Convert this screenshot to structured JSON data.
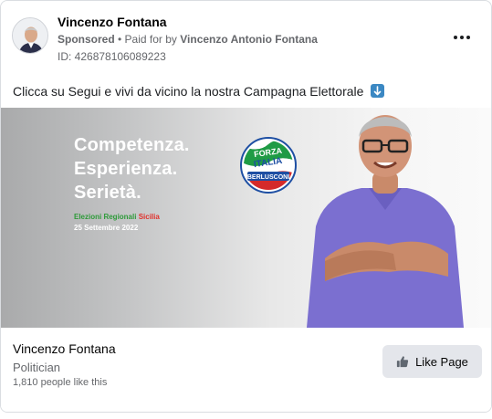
{
  "header": {
    "page_name": "Vincenzo Fontana",
    "sponsored_label": "Sponsored",
    "separator": " • ",
    "paid_for_prefix": "Paid for by ",
    "paid_for_name": "Vincenzo Antonio Fontana",
    "ad_id": "ID: 426878106089223",
    "more_icon": "more-horizontal-icon"
  },
  "post": {
    "caption": "Clicca su Segui e vivi da vicino la nostra Campagna Elettorale",
    "caption_emoji": "arrow-down-emoji"
  },
  "creative": {
    "headline_lines": [
      "Competenza.",
      "Esperienza.",
      "Serietà."
    ],
    "election_green": "Elezioni Regionali",
    "election_red": "Sicilia",
    "election_date": "25 Settembre 2022",
    "logo_text_top": "FORZA",
    "logo_text_mid": "ITALIA",
    "logo_text_bottom": "BERLUSCONI"
  },
  "footer": {
    "name": "Vincenzo Fontana",
    "category": "Politician",
    "likes": "1,810 people like this",
    "like_button_label": "Like Page",
    "like_icon": "thumbs-up-icon"
  },
  "colors": {
    "text_secondary": "#65676b",
    "button_bg": "#e4e6eb",
    "shirt": "#7b6fd0",
    "emoji_blue": "#3b88c3"
  }
}
